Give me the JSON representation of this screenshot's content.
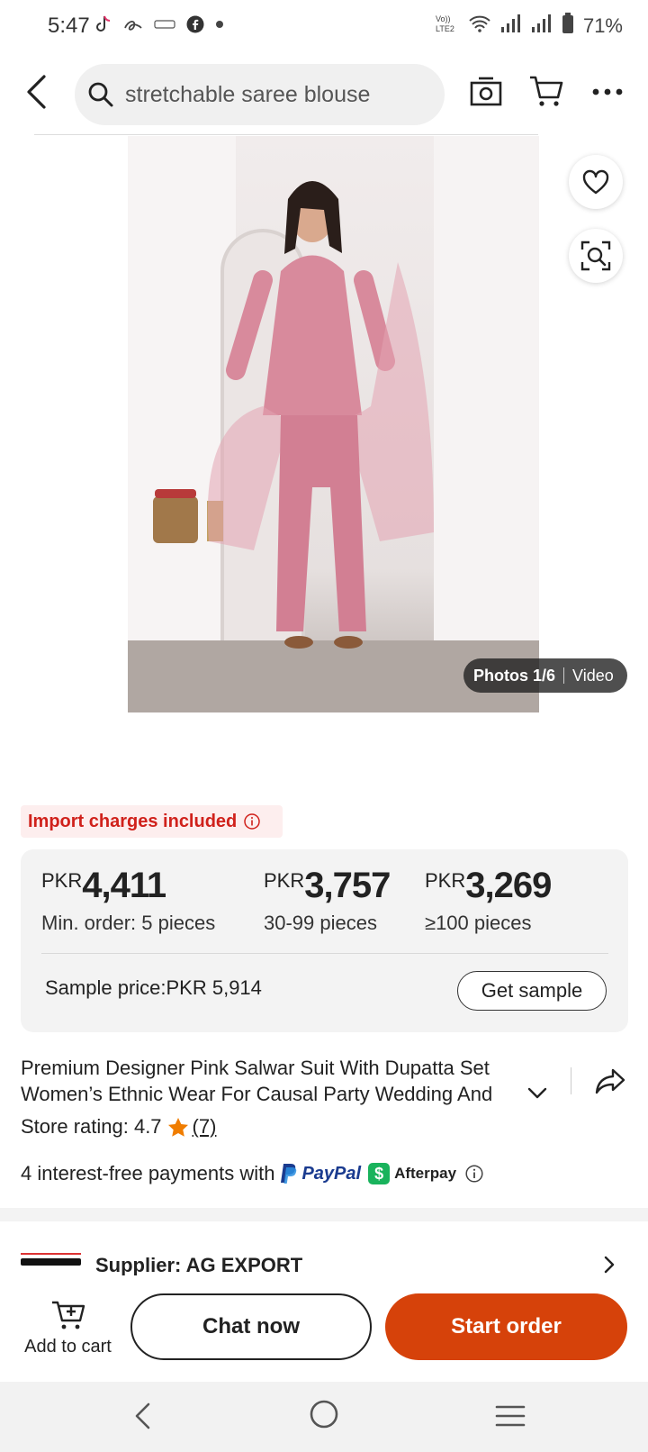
{
  "status_bar": {
    "time": "5:47",
    "left_icons": [
      "tiktok-icon",
      "alibaba-icon",
      "wemu-icon",
      "facebook-icon",
      "dot-icon"
    ],
    "network_label": "Vo)) LTE2",
    "battery": "71%"
  },
  "header": {
    "search_text": "stretchable saree blouse"
  },
  "gallery": {
    "photos_label": "Photos 1/6",
    "video_label": "Video"
  },
  "import_badge": "Import charges included",
  "pricing": {
    "tiers": [
      {
        "currency": "PKR",
        "value": "4,411",
        "qty": "Min. order: 5 pieces"
      },
      {
        "currency": "PKR",
        "value": "3,757",
        "qty": "30-99 pieces"
      },
      {
        "currency": "PKR",
        "value": "3,269",
        "qty": "≥100 pieces"
      }
    ],
    "sample_price": "Sample price:PKR 5,914",
    "get_sample": "Get sample"
  },
  "product": {
    "title": "Premium Designer Pink Salwar Suit With Dupatta Set Women’s Ethnic Wear For Causal Party Wedding And",
    "store_rating_label": "Store rating: 4.7",
    "rating_count": "(7)",
    "payments_text": "4 interest-free payments with",
    "paypal_label": "PayPal",
    "afterpay_label": "Afterpay"
  },
  "supplier": {
    "label": "Supplier:  AG EXPORT"
  },
  "actions": {
    "add_to_cart": "Add to cart",
    "chat_now": "Chat now",
    "start_order": "Start order"
  },
  "colors": {
    "accent": "#d6420a",
    "badge_red": "#d0211b",
    "star": "#f07d00"
  }
}
